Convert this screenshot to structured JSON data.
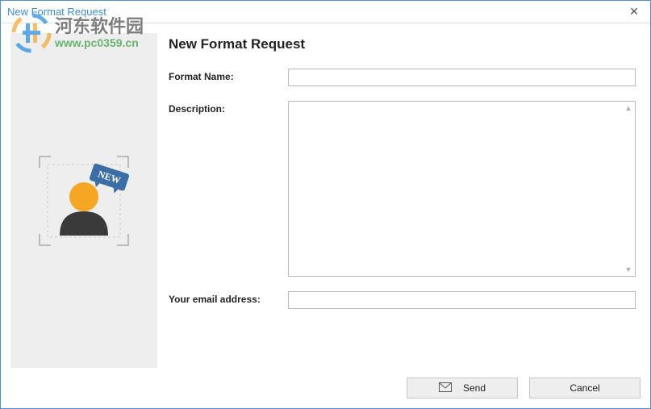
{
  "window": {
    "title": "New Format Request"
  },
  "form": {
    "heading": "New Format Request",
    "format_name_label": "Format Name:",
    "format_name_value": "",
    "description_label": "Description:",
    "description_value": "",
    "email_label": "Your email address:",
    "email_value": ""
  },
  "buttons": {
    "send": "Send",
    "cancel": "Cancel"
  },
  "sidebar": {
    "badge_text": "NEW"
  },
  "watermark": {
    "text1": "河东软件园",
    "text2": "www.pc0359.cn"
  }
}
